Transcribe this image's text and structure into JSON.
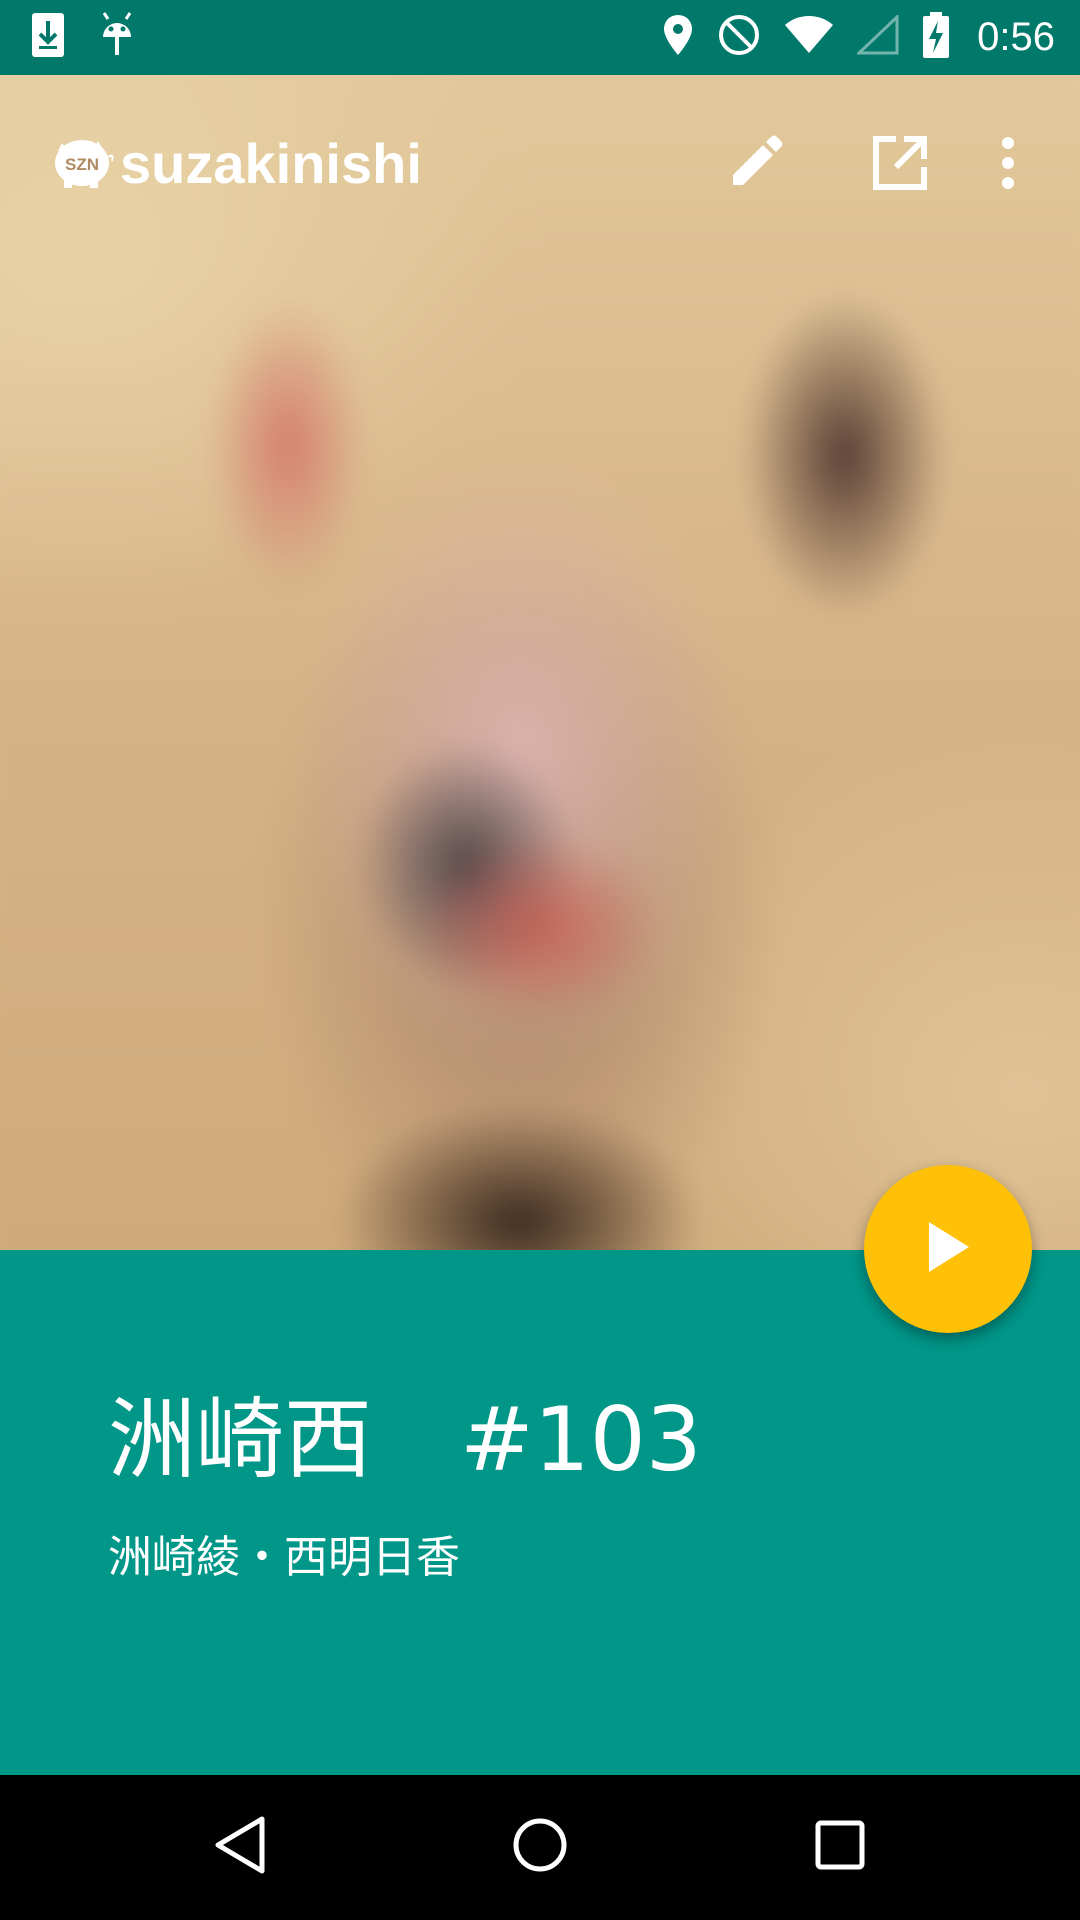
{
  "status_bar": {
    "time": "0:56",
    "left_icons": [
      "download-icon",
      "android-debug-icon"
    ],
    "right_icons": [
      "location-icon",
      "do-not-disturb-icon",
      "wifi-icon",
      "cell-signal-icon",
      "battery-charging-icon"
    ]
  },
  "app_bar": {
    "logo_text": "SZN",
    "title": "suzakinishi",
    "actions": [
      "edit-icon",
      "open-in-new-icon",
      "more-vert-icon"
    ]
  },
  "episode": {
    "title": "洲崎西　#103",
    "subtitle": "洲崎綾・西明日香"
  },
  "fab": {
    "icon": "play-icon"
  },
  "nav_bar": {
    "buttons": [
      "back-icon",
      "home-icon",
      "recents-icon"
    ]
  },
  "colors": {
    "status_bar": "#00796b",
    "panel": "#009688",
    "fab": "#ffc107"
  }
}
